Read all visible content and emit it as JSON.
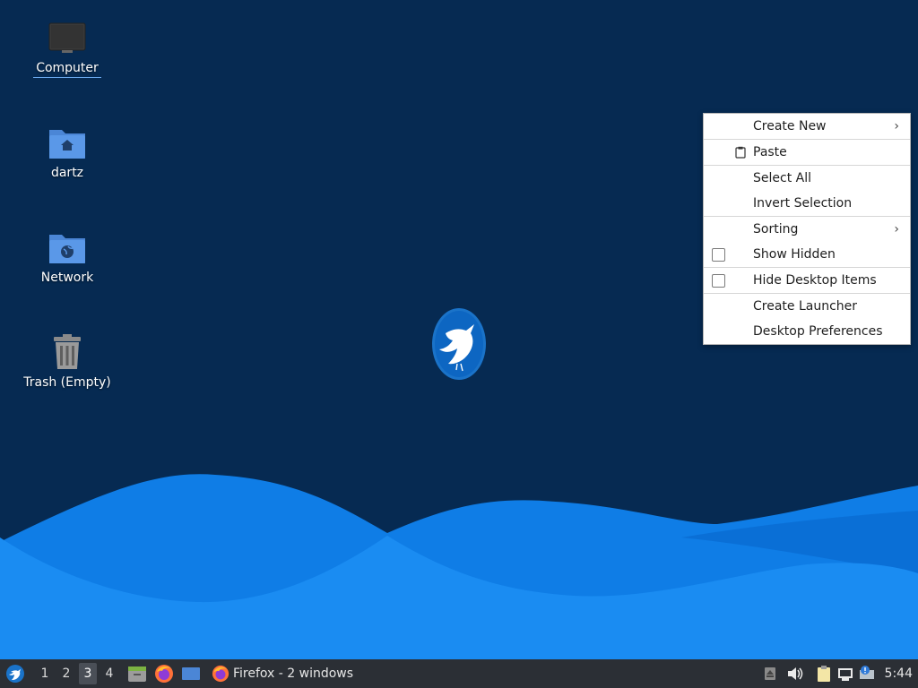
{
  "desktop": {
    "icons": [
      {
        "label": "Computer",
        "icon": "computer-icon"
      },
      {
        "label": "dartz",
        "icon": "home-folder-icon"
      },
      {
        "label": "Network",
        "icon": "network-folder-icon"
      },
      {
        "label": "Trash (Empty)",
        "icon": "trash-icon"
      }
    ]
  },
  "context_menu": {
    "items": {
      "create_new": "Create New",
      "paste": "Paste",
      "select_all": "Select All",
      "invert_selection": "Invert Selection",
      "sorting": "Sorting",
      "show_hidden": "Show Hidden",
      "hide_desktop_items": "Hide Desktop Items",
      "create_launcher": "Create Launcher",
      "desktop_preferences": "Desktop Preferences"
    },
    "show_hidden_checked": false,
    "hide_desktop_items_checked": false
  },
  "taskbar": {
    "workspaces": [
      "1",
      "2",
      "3",
      "4"
    ],
    "active_workspace": "3",
    "firefox_task": "Firefox - 2 windows",
    "clock": "5:44"
  },
  "colors": {
    "background": "#062a52",
    "wave_light": "#1a8cf2",
    "wave_dark": "#0a6fd6",
    "menu_bg": "#ffffff",
    "taskbar_bg": "#2b2f35"
  }
}
